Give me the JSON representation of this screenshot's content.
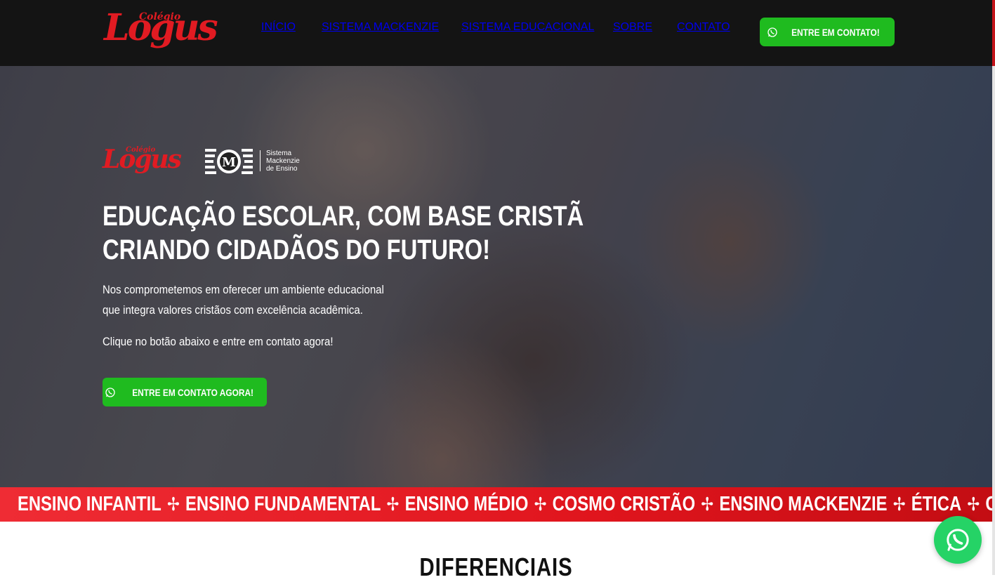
{
  "header": {
    "logo": {
      "small": "Colégio",
      "big": "Logus"
    },
    "nav": [
      "INÍCIO",
      "SISTEMA MACKENZIE",
      "SISTEMA EDUCACIONAL",
      "SOBRE",
      "CONTATO"
    ],
    "cta_label": "ENTRE EM CONTATO!",
    "cta_icon": "whatsapp-icon"
  },
  "hero": {
    "logo": {
      "small": "Colégio",
      "big": "Logus"
    },
    "partner_logo": {
      "lines": [
        "Sistema",
        "Mackenzie",
        "de Ensino"
      ]
    },
    "title_line1": "EDUCAÇÃO ESCOLAR, COM BASE CRISTÃ",
    "title_line2": "CRIANDO CIDADÃOS DO FUTURO!",
    "paragraph_line1": "Nos comprometemos em oferecer um ambiente educacional",
    "paragraph_line2": "que integra valores cristãos com excelência acadêmica.",
    "call": "Clique no botão abaixo e entre em contato agora!",
    "cta_label": "ENTRE EM CONTATO AGORA!",
    "cta_icon": "whatsapp-icon"
  },
  "ticker": {
    "items": [
      "ENSINO INFANTIL",
      "ENSINO FUNDAMENTAL",
      "ENSINO MÉDIO",
      "COSMO CRISTÃO",
      "ENSINO MACKENZIE",
      "ÉTICA",
      "COMPROMISSO"
    ],
    "separator_icon": "cross-icon"
  },
  "section": {
    "title": "DIFERENCIAIS"
  },
  "floating_button": {
    "icon": "whatsapp-icon"
  },
  "colors": {
    "header_bg": "#141414",
    "brand_red": "#e11b22",
    "cta_green": "#1fbb1f",
    "whatsapp_green": "#25d366"
  }
}
